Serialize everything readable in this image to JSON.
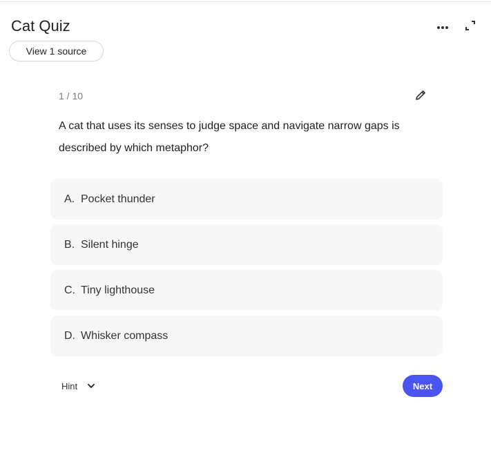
{
  "header": {
    "title": "Cat Quiz",
    "source_button": "View 1 source",
    "more_icon": "more-horiz-icon",
    "expand_icon": "fullscreen-icon"
  },
  "quiz": {
    "counter": "1 / 10",
    "edit_icon": "pencil-icon",
    "question": "A cat that uses its senses to judge space and navigate narrow gaps is described by which metaphor?",
    "options": [
      {
        "letter": "A.",
        "text": "Pocket thunder"
      },
      {
        "letter": "B.",
        "text": "Silent hinge"
      },
      {
        "letter": "C.",
        "text": "Tiny lighthouse"
      },
      {
        "letter": "D.",
        "text": "Whisker compass"
      }
    ]
  },
  "footer": {
    "hint_label": "Hint",
    "hint_icon": "chevron-down-icon",
    "next_label": "Next"
  },
  "colors": {
    "accent": "#4a55f0",
    "option_bg": "#f7f7f8",
    "muted_text": "#7a7a7a"
  }
}
